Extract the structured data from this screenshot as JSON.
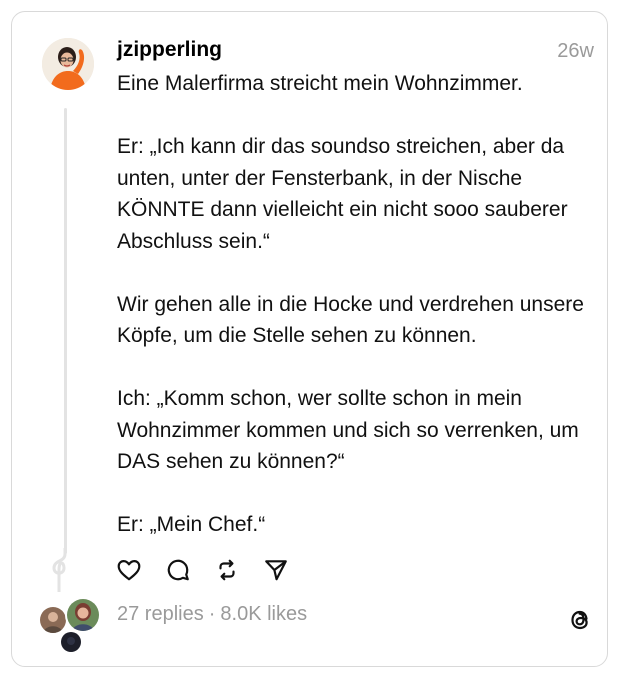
{
  "post": {
    "username": "jzipperling",
    "timestamp": "26w",
    "text": "Eine Malerfirma streicht mein Wohnzimmer.\n\nEr: „Ich kann dir das soundso streichen, aber da unten, unter der Fensterbank, in der Nische KÖNNTE dann vielleicht ein nicht sooo sauberer Abschluss sein.“\n\nWir gehen alle in die Hocke und verdrehen unsere Köpfe, um die Stelle sehen zu können.\n\nIch: „Komm schon, wer sollte schon in mein Wohnzimmer kommen und sich so verrenken, um DAS sehen zu können?“\n\nEr: „Mein Chef.“",
    "replies": "27 replies",
    "separator": "·",
    "likes": "8.0K likes"
  },
  "actions": [
    {
      "name": "like-button",
      "icon": "heart-icon"
    },
    {
      "name": "reply-button",
      "icon": "comment-icon"
    },
    {
      "name": "repost-button",
      "icon": "repost-icon"
    },
    {
      "name": "share-button",
      "icon": "send-icon"
    }
  ],
  "colors": {
    "muted_text": "#9a9a9a",
    "border": "#d9d9d9",
    "avatar_accent": "#f26b1d"
  },
  "brand": {
    "icon": "threads-logo-icon"
  }
}
